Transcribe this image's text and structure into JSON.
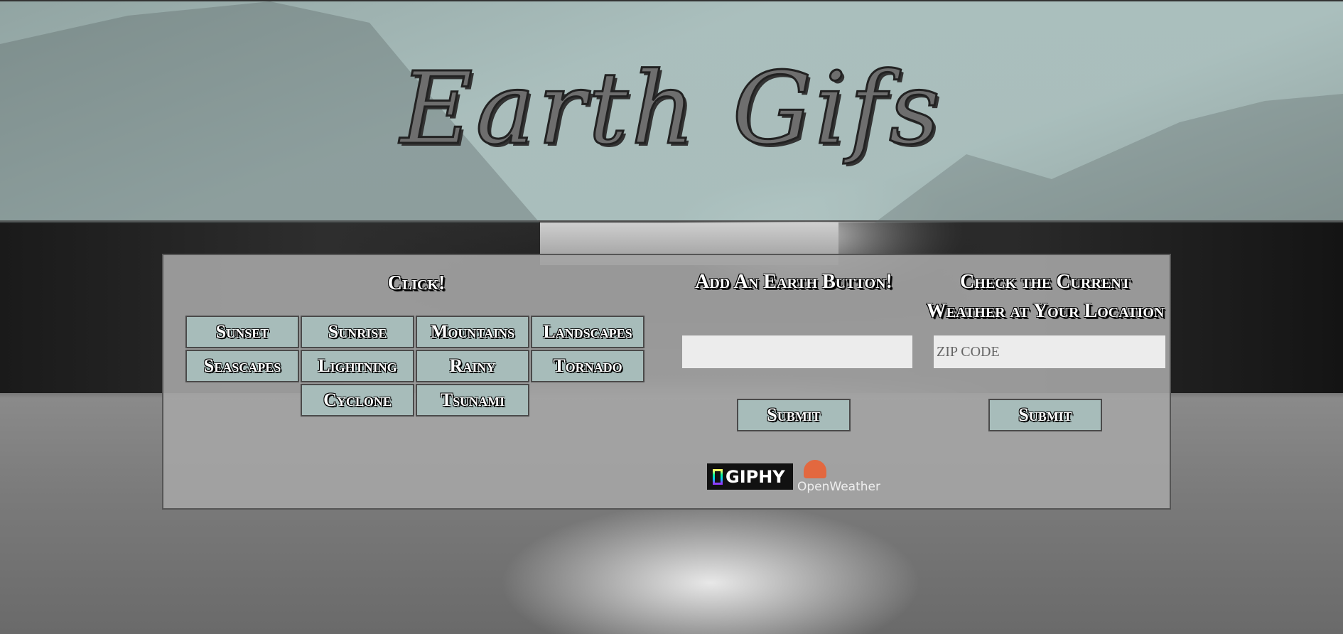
{
  "header": {
    "title": "Earth Gifs"
  },
  "buttons_section": {
    "heading": "Click!",
    "buttons": [
      "Sunset",
      "Sunrise",
      "Mountains",
      "Landscapes",
      "Seascapes",
      "Lightning",
      "Rainy",
      "Tornado",
      "Cyclone",
      "Tsunami"
    ]
  },
  "add_section": {
    "heading": "Add An Earth Button!",
    "input_value": "",
    "submit_label": "Submit"
  },
  "weather_section": {
    "heading_line1": "Check the Current",
    "heading_line2": "Weather at Your Location",
    "zip_placeholder": "ZIP CODE",
    "submit_label": "Submit"
  },
  "logos": {
    "giphy": "GIPHY",
    "openweather": "OpenWeather"
  },
  "colors": {
    "header_bg": "#b0c6c4",
    "button_bg": "#a7bcba",
    "panel_bg": "#a5a5a5",
    "openweather_orange": "#e3683f"
  }
}
